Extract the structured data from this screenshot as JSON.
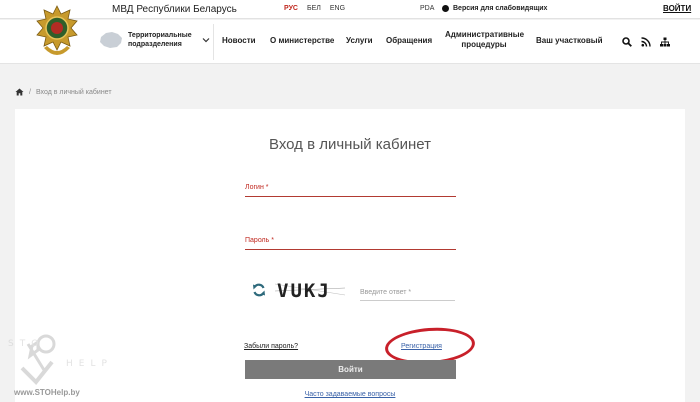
{
  "topbar": {
    "ministry": "МВД Республики Беларусь",
    "languages": [
      "РУС",
      "БЕЛ",
      "ENG"
    ],
    "pda": "PDA",
    "visually_impaired": "Версия для слабовидящих",
    "login": "ВОЙТИ"
  },
  "navbar": {
    "territory": "Территориальные подразделения",
    "items": [
      "Новости",
      "О министерстве",
      "Услуги",
      "Обращения",
      "Административные процедуры",
      "Ваш участковый"
    ],
    "icons": [
      "search-icon",
      "rss-icon",
      "sitemap-icon"
    ]
  },
  "breadcrumb": {
    "current": "Вход в личный кабинет"
  },
  "form": {
    "title": "Вход в личный кабинет",
    "login_placeholder": "Логин *",
    "password_placeholder": "Пароль *",
    "captcha_text": "VUKJ",
    "captcha_placeholder": "Введите ответ *",
    "forgot": "Забыли пароль?",
    "register": "Регистрация",
    "submit": "Войти",
    "faq": "Часто задаваемые вопросы"
  },
  "watermark": {
    "site": "www.STOHelp.by",
    "logo_text": "STO HELP"
  },
  "colors": {
    "accent": "#c0281f",
    "link": "#3a62a8",
    "button": "#7a7a7a"
  }
}
